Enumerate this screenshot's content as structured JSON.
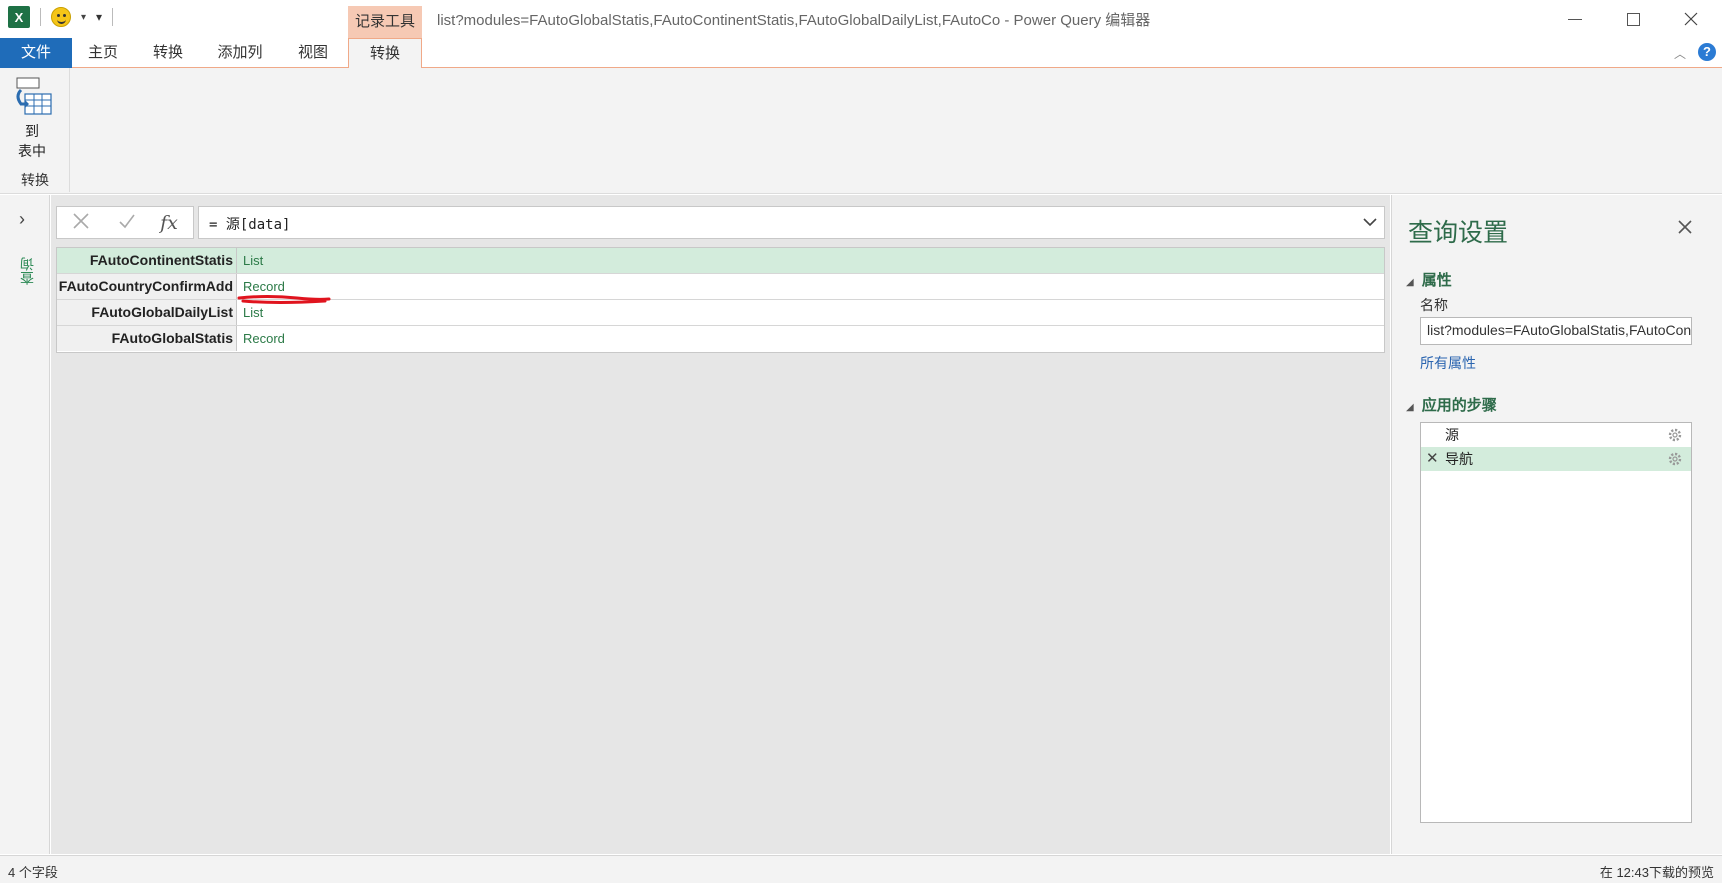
{
  "window": {
    "title": "list?modules=FAutoGlobalStatis,FAutoContinentStatis,FAutoGlobalDailyList,FAutoCo - Power Query 编辑器",
    "contextual_tab_group": "记录工具",
    "app_logo": "X"
  },
  "ribbon_tabs": {
    "file": "文件",
    "home": "主页",
    "transform": "转换",
    "add_column": "添加列",
    "view": "视图",
    "record_transform": "转换"
  },
  "ribbon": {
    "to_table_line1": "到",
    "to_table_line2": "表中",
    "group_label": "转换"
  },
  "left_pane": {
    "queries_label": "查询"
  },
  "formula": {
    "fx": "fx",
    "text": "= 源[data]"
  },
  "record_rows": [
    {
      "field": "FAutoContinentStatis",
      "value": "List"
    },
    {
      "field": "FAutoCountryConfirmAdd",
      "value": "Record"
    },
    {
      "field": "FAutoGlobalDailyList",
      "value": "List"
    },
    {
      "field": "FAutoGlobalStatis",
      "value": "Record"
    }
  ],
  "query_settings": {
    "title": "查询设置",
    "properties_header": "属性",
    "name_label": "名称",
    "name_value": "list?modules=FAutoGlobalStatis,FAutoContinentStatis,FAutoGlobalDailyList,FAutoCountryConfirmAdd",
    "all_properties_link": "所有属性",
    "applied_steps_header": "应用的步骤",
    "steps": [
      {
        "label": "源",
        "selected": false
      },
      {
        "label": "导航",
        "selected": true
      }
    ]
  },
  "status": {
    "left": "4 个字段",
    "right": "在 12:43下载的预览"
  },
  "colors": {
    "file_tab": "#1f6cb9",
    "contextual_tab": "#f6c9b4",
    "selected_row": "#d3ecdc",
    "accent_green": "#2e6b4a",
    "link_value_green": "#2b7a47",
    "annotation_red": "#e0141e"
  },
  "icons": {
    "to_table": "to-table-icon",
    "formula_cancel": "close-icon",
    "formula_commit": "check-icon",
    "formula_expand": "chevron-down-icon",
    "pane_close": "close-icon",
    "step_settings": "gear-icon"
  }
}
